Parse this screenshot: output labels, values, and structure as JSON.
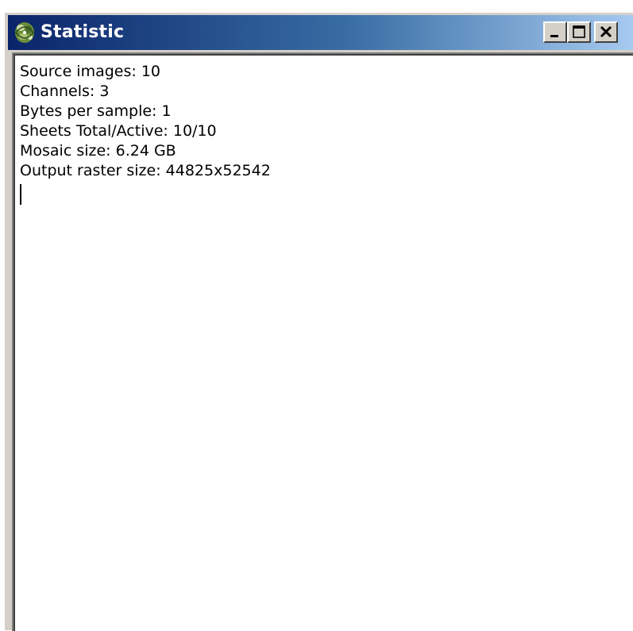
{
  "window": {
    "title": "Statistic",
    "icon": "app-logo-icon",
    "controls": {
      "minimize": "minimize-icon",
      "maximize": "maximize-icon",
      "close": "close-icon"
    }
  },
  "content": {
    "lines": [
      "Source images: 10",
      "Channels: 3",
      "Bytes per sample: 1",
      "Sheets Total/Active: 10/10",
      "Mosaic size: 6.24 GB",
      "Output raster size: 44825x52542"
    ]
  },
  "colors": {
    "titlebar_start": "#0a246a",
    "titlebar_end": "#a6caf0",
    "face": "#d4d0c8",
    "text": "#000000",
    "background": "#ffffff"
  }
}
